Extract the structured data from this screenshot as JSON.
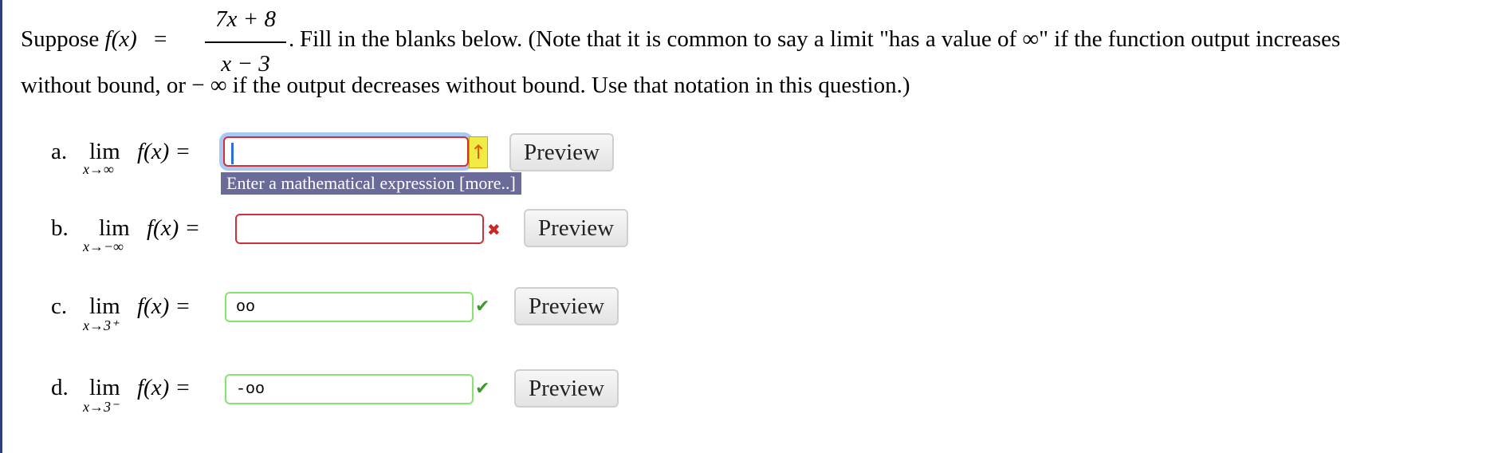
{
  "question": {
    "suppose": "Suppose",
    "fx": "f(x)",
    "eq": "=",
    "numerator": "7x + 8",
    "denominator": "x − 3",
    "dot": ".",
    "instructions": "Fill in the blanks below. (Note that it is common to say a limit \"has a value of ∞\" if the function output increases",
    "instructions2": "without bound, or − ∞ if the output decreases without bound. Use that notation in this question.)"
  },
  "parts": [
    {
      "label": "a.",
      "lim": "lim",
      "approach": "x→∞",
      "fx": "f(x) =",
      "value": "",
      "status": "focused-empty",
      "feedback": "↑",
      "preview": "Preview"
    },
    {
      "label": "b.",
      "lim": "lim",
      "approach": "x→−∞",
      "fx": "f(x) =",
      "value": "",
      "status": "incorrect",
      "feedback": "✖",
      "preview": "Preview"
    },
    {
      "label": "c.",
      "lim": "lim",
      "approach": "x→3⁺",
      "fx": "f(x) =",
      "value": "oo",
      "status": "correct",
      "feedback": "✔",
      "preview": "Preview"
    },
    {
      "label": "d.",
      "lim": "lim",
      "approach": "x→3⁻",
      "fx": "f(x) =",
      "value": "-oo",
      "status": "correct",
      "feedback": "✔",
      "preview": "Preview"
    }
  ],
  "tooltip": "Enter a mathematical expression [more..]",
  "colors": {
    "error_border": "#d0303a",
    "correct_border": "#86e36e",
    "focus_ring": "#a9c9f5",
    "tooltip_bg": "#6b6b9a"
  }
}
